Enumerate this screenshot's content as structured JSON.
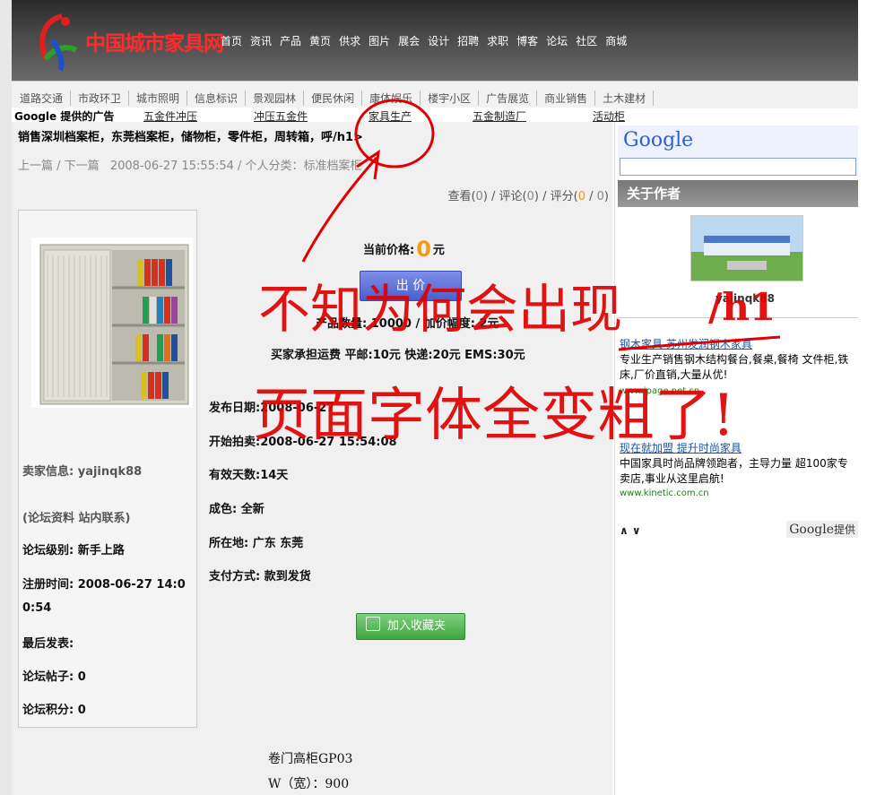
{
  "site": {
    "logo_text": "中国城市家具网",
    "nav": [
      "首页",
      "资讯",
      "产品",
      "黄页",
      "供求",
      "图片",
      "展会",
      "设计",
      "招聘",
      "求职",
      "博客",
      "论坛",
      "社区",
      "商城"
    ]
  },
  "categories": [
    "道路交通",
    "市政环卫",
    "城市照明",
    "信息标识",
    "景观园林",
    "便民休闲",
    "康体娱乐",
    "楼宇小区",
    "广告展览",
    "商业销售",
    "土木建材"
  ],
  "adbar": {
    "label": "Google 提供的广告",
    "links": [
      "五金件冲压",
      "冲压五金件",
      "家具生产",
      "五金制造厂",
      "活动柜"
    ]
  },
  "post": {
    "title": "销售深圳档案柜，东莞档案柜，储物柜，零件柜，周转箱，呼/h1>",
    "prev": "上一篇",
    "next": "/ 下一篇",
    "meta": "2008-06-27 15:55:54 / 个人分类：标准档案柜",
    "stats": {
      "view_label": "查看(",
      "view": "0",
      "comment_label": ") / 评论(",
      "comment": "0",
      "score_label": ") / 评分(",
      "score_a": "0",
      "sep": " / ",
      "score_b": "0",
      "end": ")"
    }
  },
  "seller": {
    "info": "卖家信息: yajinqk88",
    "links": "(论坛资料  站内联系)",
    "level": "论坛级别: 新手上路",
    "reg_1": "注册时间: 2008-06-27 14:0",
    "reg_2": "0:54",
    "last_post": "最后发表:",
    "posts": "论坛帖子: 0",
    "points": "论坛积分: 0"
  },
  "product": {
    "price_label": "当前价格:",
    "price": "0",
    "price_unit": "元",
    "bid_label": "出 价",
    "qty": "产品数量: 10000 / 加价幅度: 2元",
    "shipping": "买家承担运费  平邮:10元  快递:20元  EMS:30元",
    "publish": "发布日期:2008-06-27",
    "start": "开始拍卖:2008-06-27 15:54:08",
    "valid": "有效天数:14天",
    "condition": "成色: 全新",
    "location": "所在地: 广东  东莞",
    "payment": "支付方式: 款到发货",
    "fav_label": "加入收藏夹",
    "name": "卷门高柜GP03",
    "size": "W（宽）：900"
  },
  "sidebar": {
    "google": "Google",
    "about": "关于作者",
    "author": "yajinqk88",
    "ads": [
      {
        "title": "钢木家具 苏州发润钢木家具",
        "desc": "专业生产销售钢木结构餐台,餐桌,餐椅 文件柜,铁床,厂价直销,大量从优!",
        "url": "www.ipage.net.cn"
      },
      {
        "title": "现在就加盟 提升时尚家具",
        "desc": "中国家具时尚品牌领跑者，主导力量 超100家专卖店,事业从这里启航!",
        "url": "www.kinetic.com.cn"
      }
    ],
    "ad_nav": "∧ ∨",
    "ad_footer": "Google",
    "ad_footer_suffix": "提供"
  },
  "annotation": {
    "line1": "不知为何会出现",
    "tag": "/h1",
    "line2": "页面字体全变粗了!"
  },
  "colors": {
    "accent": "#f39c12",
    "annotation": "#e00000",
    "logo": "#ff2b2b"
  }
}
